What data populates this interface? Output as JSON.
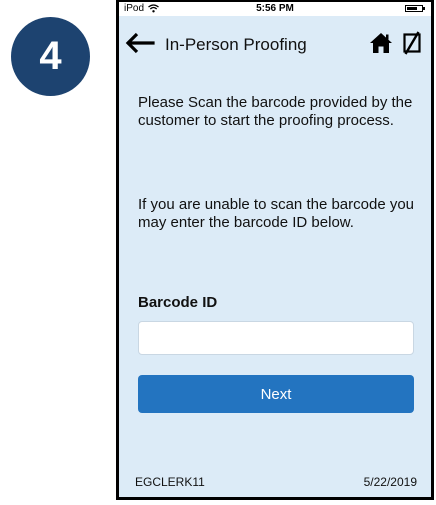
{
  "step": {
    "number": "4"
  },
  "status_bar": {
    "carrier": "iPod",
    "time": "5:56 PM"
  },
  "nav": {
    "title": "In-Person Proofing",
    "icons": {
      "back": "back-arrow-icon",
      "home": "home-icon",
      "sync": "sync-disabled-icon"
    }
  },
  "instructions": {
    "paragraph_1": "Please Scan the barcode provided by the customer to start the proofing process.",
    "paragraph_2": "If you are unable to scan the barcode you may enter the barcode ID below."
  },
  "form": {
    "barcode_label": "Barcode ID",
    "barcode_value": "",
    "barcode_placeholder": "",
    "next_label": "Next"
  },
  "footer": {
    "user": "EGCLERK11",
    "date": "5/22/2019"
  },
  "colors": {
    "badge": "#1d4370",
    "screen_background": "#dcebf7",
    "primary_button": "#2374c0"
  }
}
